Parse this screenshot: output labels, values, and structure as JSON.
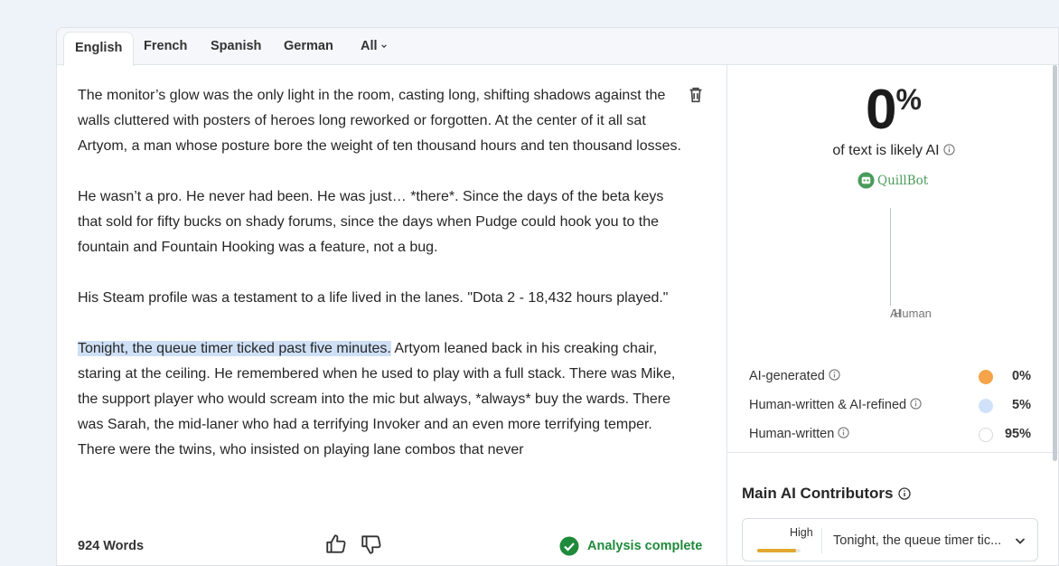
{
  "tabs": {
    "english": "English",
    "french": "French",
    "spanish": "Spanish",
    "german": "German",
    "all": "All"
  },
  "editor": {
    "p1": "The monitor’s glow was the only light in the room, casting long, shifting shadows against the walls cluttered with posters of heroes long reworked or forgotten. At the center of it all sat Artyom, a man whose posture bore the weight of ten thousand hours and ten thousand losses.",
    "p2": "He wasn’t a pro. He never had been. He was just… *there*. Since the days of the beta keys that sold for fifty bucks on shady forums, since the days when Pudge could hook you to the fountain and Fountain Hooking was a feature, not a bug.",
    "p3": "His Steam profile was a testament to a life lived in the lanes. \"Dota 2 - 18,432 hours played.\"",
    "p4_highlight": "Tonight, the queue timer ticked past five minutes.",
    "p4_rest": " Artyom leaned back in his creaking chair, staring at the ceiling. He remembered when he used to play with a full stack. There was Mike, the support player who would scream into the mic but always, *always* buy the wards. There was Sarah, the mid-laner who had a terrifying Invoker and an even more terrifying temper. There were the twins, who insisted on playing lane combos that never"
  },
  "footer": {
    "word_count": "924 Words",
    "status": "Analysis complete"
  },
  "result": {
    "score": "0",
    "percent_sign": "%",
    "caption": "of text is likely AI",
    "brand": "QuillBot",
    "chart_labels": [
      "AI",
      "Human"
    ],
    "legend": [
      {
        "label": "AI-generated",
        "value": "0%",
        "color": "#f5a44a"
      },
      {
        "label": "Human-written & AI-refined",
        "value": "5%",
        "color": "#cfe2fa"
      },
      {
        "label": "Human-written",
        "value": "95%",
        "color": "#ffffff"
      }
    ]
  },
  "contributors": {
    "title": "Main AI Contributors",
    "level": "High",
    "level_fraction": 0.9,
    "sentence": "Tonight, the queue timer tic..."
  }
}
